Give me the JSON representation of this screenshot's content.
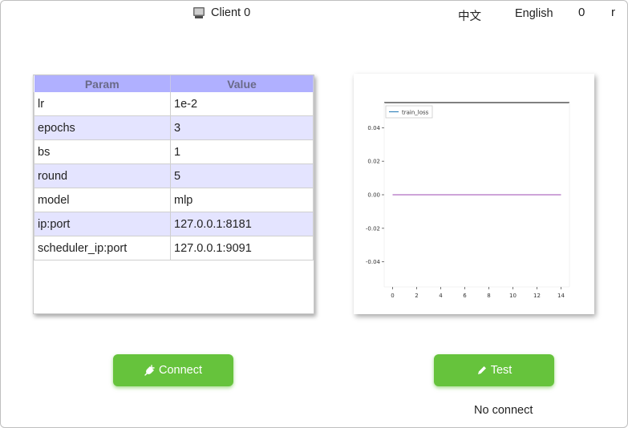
{
  "header": {
    "title": "Client 0",
    "lang_zh": "中文",
    "lang_en": "English",
    "counter": "0",
    "trailing": "r"
  },
  "params_table": {
    "headers": [
      "Param",
      "Value"
    ],
    "rows": [
      [
        "lr",
        "1e-2"
      ],
      [
        "epochs",
        "3"
      ],
      [
        "bs",
        "1"
      ],
      [
        "round",
        "5"
      ],
      [
        "model",
        "mlp"
      ],
      [
        "ip:port",
        "127.0.0.1:8181"
      ],
      [
        "scheduler_ip:port",
        "127.0.0.1:9091"
      ]
    ],
    "row_colors": [
      "#ffffff",
      "#e4e4ff"
    ]
  },
  "chart_data": {
    "type": "line",
    "x": [
      0,
      1,
      2,
      3,
      4,
      5,
      6,
      7,
      8,
      9,
      10,
      11,
      12,
      13,
      14
    ],
    "series": [
      {
        "name": "train_loss",
        "values": [
          0,
          0,
          0,
          0,
          0,
          0,
          0,
          0,
          0,
          0,
          0,
          0,
          0,
          0,
          0
        ],
        "color": "#9c4ab3"
      }
    ],
    "xticks": [
      0,
      2,
      4,
      6,
      8,
      10,
      12,
      14
    ],
    "yticks": [
      0.04,
      0.02,
      0.0,
      -0.02,
      -0.04
    ],
    "ytick_labels": [
      "0.04",
      "0.02",
      "0.00",
      "-0.02",
      "-0.04"
    ],
    "xlim": [
      -0.7,
      14.7
    ],
    "ylim": [
      -0.055,
      0.055
    ],
    "legend": "top-left"
  },
  "buttons": {
    "connect_label": "Connect",
    "test_label": "Test"
  },
  "status_text": "No connect",
  "colors": {
    "accent": "#66c33c",
    "table_header": "#b0b0ff",
    "table_alt_row": "#e4e4ff"
  }
}
